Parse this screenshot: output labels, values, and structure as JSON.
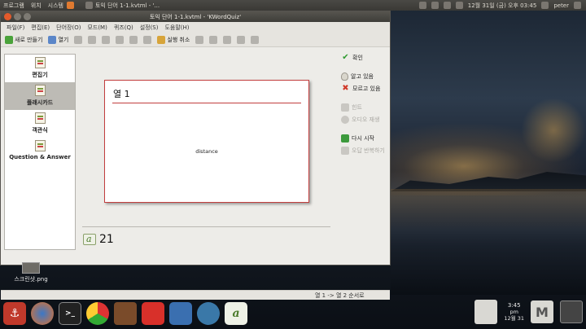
{
  "top_panel": {
    "menus": [
      "프로그램",
      "위치",
      "시스템"
    ],
    "task_title": "토익 단어 1-1.kvtml - '...",
    "clock": "12월 31일 (금) 오후 03:45",
    "user": "peter"
  },
  "window": {
    "title": "토익 단어 1-1.kvtml - 'KWordQuiz'",
    "menu": [
      "파일(F)",
      "편집(E)",
      "단어장(O)",
      "모드(M)",
      "퀴즈(Q)",
      "설정(S)",
      "도움말(H)"
    ],
    "toolbar": {
      "new_label": "새로 만들기",
      "open_label": "열기",
      "undo_label": "실행 취소"
    },
    "modes": [
      {
        "label": "편집기"
      },
      {
        "label": "플래시카드"
      },
      {
        "label": "객관식"
      },
      {
        "label": "Question & Answer"
      }
    ],
    "card": {
      "column_title": "열 1",
      "word": "distance"
    },
    "actions": {
      "check": "확인",
      "know": "알고 있음",
      "dont_know": "모르고 있음",
      "hint": "힌트",
      "audio": "오디오 재생",
      "restart": "다시 시작",
      "repeat_errors": "오답 반복하기"
    },
    "score": "21",
    "status": "열 1 -> 열 2 순서로"
  },
  "desktop": {
    "file_label": "스크린샷.png"
  },
  "dock": {
    "terminal_glyph": ">_",
    "clock_time": "3:45",
    "clock_ampm": "pm",
    "clock_date": "12월 31"
  }
}
